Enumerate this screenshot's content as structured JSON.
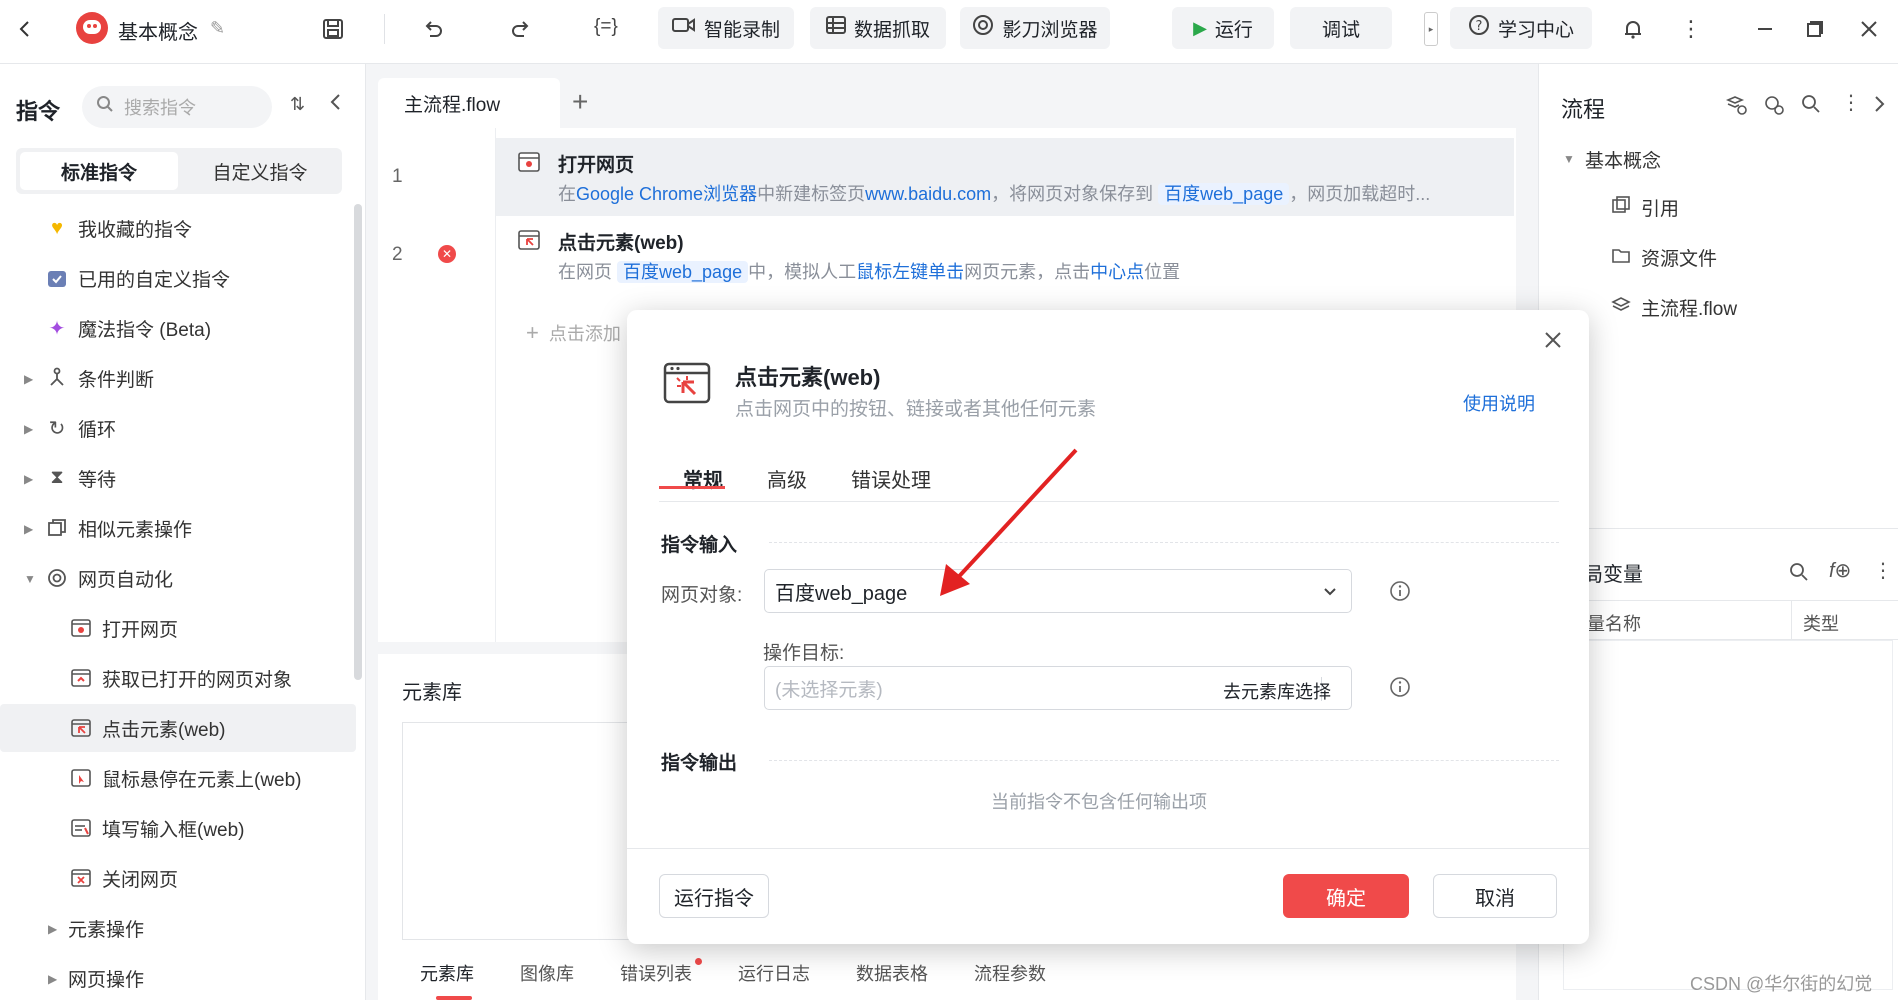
{
  "topbar": {
    "project_title": "基本概念",
    "buttons": {
      "smart_record": "智能录制",
      "data_scrape": "数据抓取",
      "browser": "影刀浏览器",
      "run": "运行",
      "debug": "调试",
      "learn": "学习中心"
    },
    "code_icon_text": "{=}"
  },
  "left": {
    "title": "指令",
    "search_placeholder": "搜索指令",
    "tabs": [
      "标准指令",
      "自定义指令"
    ],
    "items": [
      {
        "label": "我收藏的指令"
      },
      {
        "label": "已用的自定义指令"
      },
      {
        "label": "魔法指令 (Beta)"
      },
      {
        "label": "条件判断"
      },
      {
        "label": "循环"
      },
      {
        "label": "等待"
      },
      {
        "label": "相似元素操作"
      },
      {
        "label": "网页自动化"
      },
      {
        "label": "打开网页"
      },
      {
        "label": "获取已打开的网页对象"
      },
      {
        "label": "点击元素(web)"
      },
      {
        "label": "鼠标悬停在元素上(web)"
      },
      {
        "label": "填写输入框(web)"
      },
      {
        "label": "关闭网页"
      },
      {
        "label": "元素操作"
      },
      {
        "label": "网页操作"
      }
    ]
  },
  "center": {
    "tab_label": "主流程.flow",
    "add_tab": "+",
    "steps": [
      {
        "num": "1",
        "title": "打开网页",
        "d1": "在",
        "d2": "Google Chrome浏览器",
        "d3": "中新建标签页",
        "d4": "www.baidu.com",
        "d5": "，将网页对象保存到",
        "d6": "百度web_page",
        "d7": "，网页加载超时..."
      },
      {
        "num": "2",
        "title": "点击元素(web)",
        "d1": "在网页",
        "d2": "百度web_page",
        "d3": "中，模拟人工",
        "d4": "鼠标左键单击",
        "d5": "网页元素，点击",
        "d6": "中心点",
        "d7": "位置"
      }
    ],
    "add_step": "点击添加",
    "element_lib_title": "元素库",
    "bottom_tabs": [
      "元素库",
      "图像库",
      "错误列表",
      "运行日志",
      "数据表格",
      "流程参数"
    ]
  },
  "right": {
    "title": "流程",
    "tree_root": "基本概念",
    "tree_items": [
      "引用",
      "资源文件",
      "主流程.flow"
    ],
    "vars_title": "局变量",
    "col_name": "量名称",
    "col_type": "类型"
  },
  "dialog": {
    "title": "点击元素(web)",
    "subtitle": "点击网页中的按钮、链接或者其他任何元素",
    "help_link": "使用说明",
    "tabs": [
      "常规",
      "高级",
      "错误处理"
    ],
    "section_input": "指令输入",
    "web_object_label": "网页对象:",
    "web_object_value": "百度web_page",
    "target_label": "操作目标:",
    "target_placeholder": "(未选择元素)",
    "target_button": "去元素库选择",
    "section_output": "指令输出",
    "output_empty": "当前指令不包含任何输出项",
    "run_button": "运行指令",
    "ok_button": "确定",
    "cancel_button": "取消"
  },
  "watermark": "CSDN @华尔街的幻觉",
  "colors": {
    "accent": "#f04a4a",
    "link": "#1e6fd9"
  }
}
